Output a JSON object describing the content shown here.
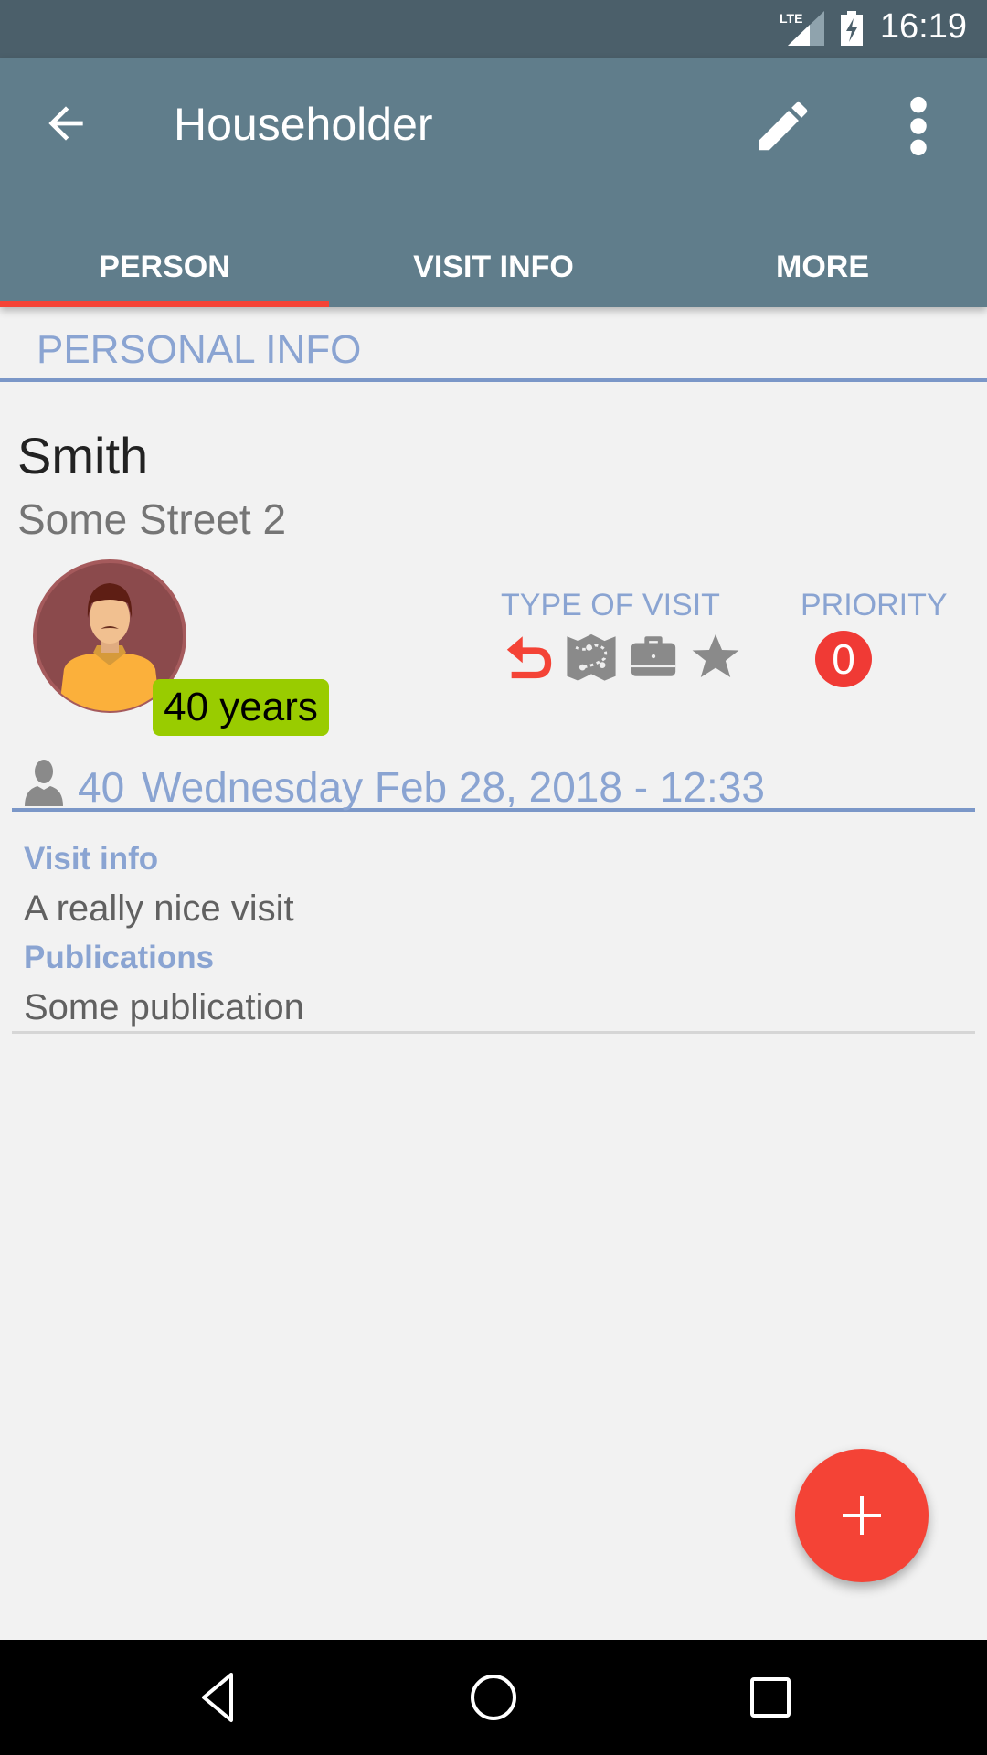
{
  "status_bar": {
    "network": "LTE",
    "time": "16:19"
  },
  "app_bar": {
    "title": "Householder",
    "back_icon": "arrow-back-icon",
    "edit_icon": "pencil-icon",
    "more_icon": "more-vert-icon"
  },
  "tabs": [
    {
      "label": "PERSON",
      "selected": true
    },
    {
      "label": "VISIT INFO",
      "selected": false
    },
    {
      "label": "MORE",
      "selected": false
    }
  ],
  "section": {
    "title": "PERSONAL INFO"
  },
  "person": {
    "name": "Smith",
    "address": "Some Street 2",
    "age_badge": "40 years"
  },
  "type_of_visit": {
    "label": "TYPE OF VISIT",
    "icons": [
      "return-visit-icon",
      "map-icon",
      "briefcase-icon",
      "star-icon"
    ]
  },
  "priority": {
    "label": "PRIORITY",
    "value": "0"
  },
  "visit": {
    "count": "40",
    "date": "Wednesday Feb 28, 2018 - 12:33",
    "details": [
      {
        "label": "Visit info",
        "value": "A really nice visit"
      },
      {
        "label": "Publications",
        "value": "Some publication"
      }
    ]
  },
  "fab": {
    "icon": "plus-icon"
  },
  "nav_bar": {
    "buttons": [
      "back-nav-icon",
      "home-nav-icon",
      "recents-nav-icon"
    ]
  },
  "colors": {
    "primary": "#607d8b",
    "primary_dark": "#4b5f6a",
    "accent": "#f44336",
    "label_blue": "#8aa4d2",
    "age_badge": "#99cc00"
  }
}
